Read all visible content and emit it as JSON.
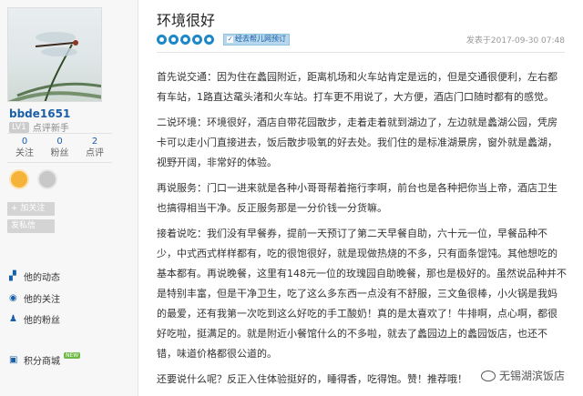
{
  "sidebar": {
    "username": "bbde1651",
    "level_badge": "LV1",
    "level_name": "点评新手",
    "stats": [
      {
        "num": "0",
        "label": "关注"
      },
      {
        "num": "0",
        "label": "粉丝"
      },
      {
        "num": "2",
        "label": "点评"
      }
    ],
    "follow_button": "+ 加关注",
    "message_button": "发私信",
    "nav": {
      "dynamic": "他的动态",
      "following": "他的关注",
      "fans": "他的粉丝",
      "store": "积分商城",
      "store_tag": "NEW"
    }
  },
  "review": {
    "title": "环境很好",
    "rating": 5,
    "trip_tag": "经去帮儿网预订",
    "post_time": "发表于2017-09-30 07:48",
    "paragraphs": [
      "首先说交通：因为住在蠡园附近，距离机场和火车站肯定是远的，但是交通很便利，左右都有车站，1路直达鼋头渚和火车站。打车更不用说了，大方便，酒店门口随时都有的感觉。",
      "二说环境：环境很好，酒店自带花园散步，走着走着就到湖边了，左边就是蠡湖公园，凭房卡可以走小门直接进去，饭后散步吸氧的好去处。我们住的是标准湖景房，窗外就是蠡湖，视野开阔，非常好的体验。",
      "再说服务：门口一进来就是各种小哥哥帮着拖行李啊，前台也是各种把你当上帝，酒店卫生也搞得相当干净。反正服务那是一分价钱一分货嘛。",
      "接着说吃：我们没有早餐券，提前一天预订了第二天早餐自助，六十元一位，早餐品种不少，中式西式样样都有，吃的很饱很好，就是现做热烧的不多，只有面条馄饨。其他想吃的基本都有。再说晚餐，这里有148元一位的玫瑰园自助晚餐，那也是极好的。虽然说品种并不是特别丰富，但是干净卫生，吃了这么多东西一点没有不舒服，三文鱼很棒，小火锅是我妈的最爱，还有我第一次吃到这么好吃的手工酸奶！真的是太喜欢了！牛排啊，点心啊，都很好吃啦，挺满足的。就是附近小餐馆什么的不多啦，就去了蠡园边上的蠡园饭店，也还不错，味道价格都很公道的。",
      "还要说什么呢？反正入住体验挺好的，睡得香，吃得饱。赞！推荐哦！"
    ]
  },
  "watermark": "无锡湖滨饭店",
  "colors": {
    "accent": "#1a5fa8",
    "star": "#1d88c8",
    "sidebar_bg": "#f7f7f7"
  }
}
